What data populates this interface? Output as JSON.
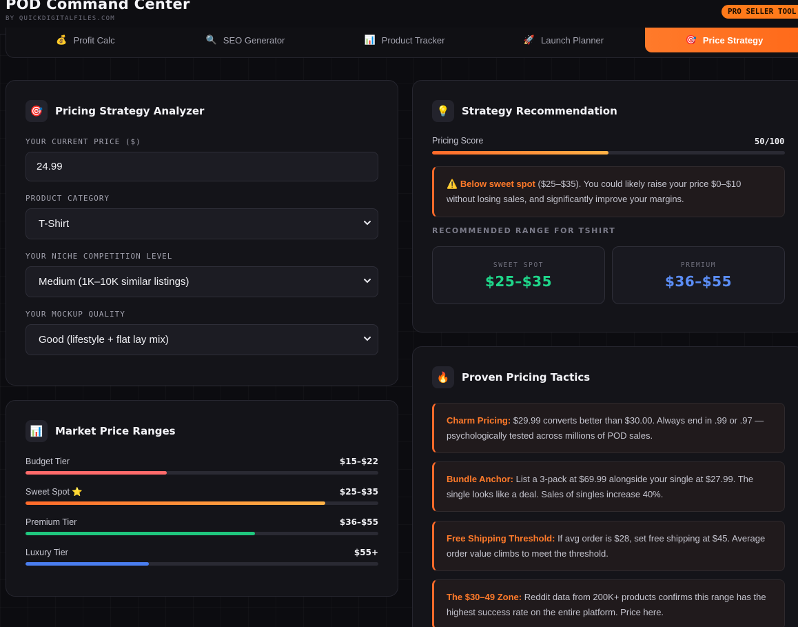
{
  "header": {
    "title": "POD Command Center",
    "subtitle": "BY QUICKDIGITALFILES.COM",
    "badge": "PRO SELLER TOOL"
  },
  "tabs": [
    {
      "icon": "💰",
      "label": "Profit Calc",
      "active": false
    },
    {
      "icon": "🔍",
      "label": "SEO Generator",
      "active": false
    },
    {
      "icon": "📊",
      "label": "Product Tracker",
      "active": false
    },
    {
      "icon": "🚀",
      "label": "Launch Planner",
      "active": false
    },
    {
      "icon": "🎯",
      "label": "Price Strategy",
      "active": true
    }
  ],
  "analyzer": {
    "icon": "🎯",
    "title": "Pricing Strategy Analyzer",
    "price_label": "YOUR CURRENT PRICE ($)",
    "price_value": "24.99",
    "category_label": "PRODUCT CATEGORY",
    "category_value": "T-Shirt",
    "competition_label": "YOUR NICHE COMPETITION LEVEL",
    "competition_value": "Medium (1K–10K similar listings)",
    "mockup_label": "YOUR MOCKUP QUALITY",
    "mockup_value": "Good (lifestyle + flat lay mix)"
  },
  "market": {
    "icon": "📊",
    "title": "Market Price Ranges",
    "tiers": [
      {
        "label": "Budget Tier",
        "value": "$15–$22",
        "fill": 0.4,
        "color": "#ff6b6b"
      },
      {
        "label": "Sweet Spot ⭐",
        "value": "$25–$35",
        "fill": 0.85,
        "color": "#ff8a2a"
      },
      {
        "label": "Premium Tier",
        "value": "$36–$55",
        "fill": 0.65,
        "color": "#1fc77e"
      },
      {
        "label": "Luxury Tier",
        "value": "$55+",
        "fill": 0.35,
        "color": "#4a7ef0"
      }
    ]
  },
  "recommendation": {
    "icon": "💡",
    "title": "Strategy Recommendation",
    "score_label": "Pricing Score",
    "score_value": "50/100",
    "score_fraction": 0.5,
    "alert_icon": "⚠️",
    "alert_highlight": "Below sweet spot",
    "alert_text": " ($25–$35). You could likely raise your price $0–$10 without losing sales, and significantly improve your margins.",
    "range_heading": "RECOMMENDED RANGE FOR TSHIRT",
    "sweet_label": "SWEET SPOT",
    "sweet_value": "$25–$35",
    "premium_label": "PREMIUM",
    "premium_value": "$36–$55",
    "colors": {
      "sweet": "#1fd68a",
      "premium": "#5b8df5"
    }
  },
  "tactics": {
    "icon": "🔥",
    "title": "Proven Pricing Tactics",
    "items": [
      {
        "name": "Charm Pricing:",
        "text": " $29.99 converts better than $30.00. Always end in .99 or .97 — psychologically tested across millions of POD sales."
      },
      {
        "name": "Bundle Anchor:",
        "text": " List a 3-pack at $69.99 alongside your single at $27.99. The single looks like a deal. Sales of singles increase 40%."
      },
      {
        "name": "Free Shipping Threshold:",
        "text": " If avg order is $28, set free shipping at $45. Average order value climbs to meet the threshold."
      },
      {
        "name": "The $30–49 Zone:",
        "text": " Reddit data from 200K+ products confirms this range has the highest success rate on the entire platform. Price here."
      }
    ]
  },
  "colors": {
    "accent": "#ff7a1a"
  }
}
